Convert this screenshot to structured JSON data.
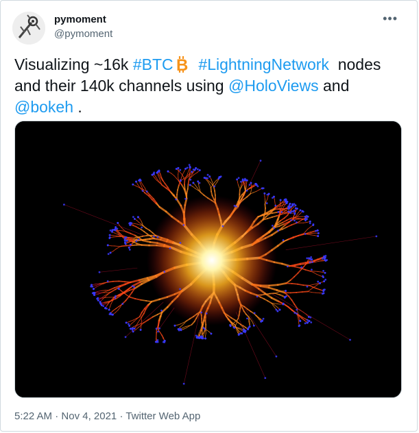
{
  "author": {
    "display_name": "pymoment",
    "handle": "@pymoment",
    "more_label": "•••"
  },
  "tweet": {
    "text_1": "Visualizing ~16k ",
    "hashtag_btc": "#BTC",
    "text_2": "  ",
    "hashtag_ln": "#LightningNetwork",
    "text_3": "  nodes and their 140k channels using ",
    "mention_holoviews": "@HoloViews",
    "text_4": " and ",
    "mention_bokeh": "@bokeh",
    "text_5": " ."
  },
  "media": {
    "icon": "lightning-network-graph-image"
  },
  "meta": {
    "time": "5:22 AM",
    "sep1": " · ",
    "date": "Nov 4, 2021",
    "sep2": " · ",
    "source": "Twitter Web App"
  },
  "colors": {
    "link": "#1d9bf0",
    "bitcoin": "#f7931a",
    "muted": "#536471"
  }
}
